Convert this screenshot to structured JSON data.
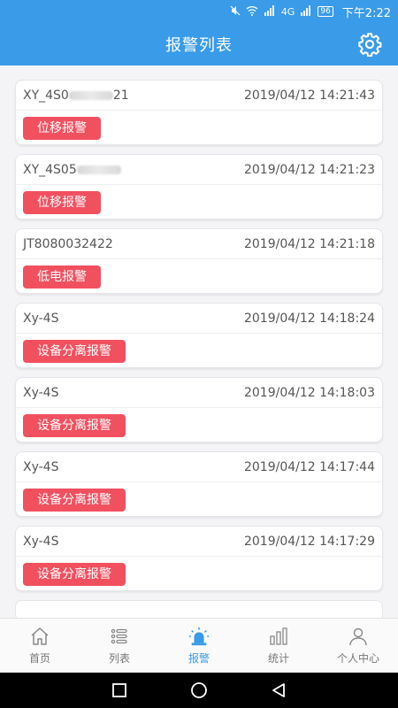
{
  "status_bar": {
    "signal_text": "4G",
    "battery": "96",
    "time": "下午2:22"
  },
  "header": {
    "title": "报警列表",
    "settings_icon": "gear-icon"
  },
  "alarms": [
    {
      "device_prefix": "XY_4S0",
      "device_suffix": "21",
      "obscured": true,
      "time": "2019/04/12 14:21:43",
      "type": "位移报警"
    },
    {
      "device_prefix": "XY_4S05",
      "device_suffix": "",
      "obscured": true,
      "time": "2019/04/12 14:21:23",
      "type": "位移报警"
    },
    {
      "device_prefix": "JT8080032422",
      "device_suffix": "",
      "obscured": false,
      "time": "2019/04/12 14:21:18",
      "type": "低电报警"
    },
    {
      "device_prefix": "Xy-4S",
      "device_suffix": "",
      "obscured": false,
      "time": "2019/04/12 14:18:24",
      "type": "设备分离报警"
    },
    {
      "device_prefix": "Xy-4S",
      "device_suffix": "",
      "obscured": false,
      "time": "2019/04/12 14:18:03",
      "type": "设备分离报警"
    },
    {
      "device_prefix": "Xy-4S",
      "device_suffix": "",
      "obscured": false,
      "time": "2019/04/12 14:17:44",
      "type": "设备分离报警"
    },
    {
      "device_prefix": "Xy-4S",
      "device_suffix": "",
      "obscured": false,
      "time": "2019/04/12 14:17:29",
      "type": "设备分离报警"
    }
  ],
  "bottom_nav": [
    {
      "label": "首页",
      "icon": "home-icon",
      "active": false
    },
    {
      "label": "列表",
      "icon": "list-icon",
      "active": false
    },
    {
      "label": "报警",
      "icon": "alarm-light-icon",
      "active": true
    },
    {
      "label": "统计",
      "icon": "bar-chart-icon",
      "active": false
    },
    {
      "label": "个人中心",
      "icon": "user-icon",
      "active": false
    }
  ],
  "colors": {
    "primary": "#3a9be8",
    "alarm_tag": "#f1505f",
    "nav_inactive": "#777777"
  }
}
